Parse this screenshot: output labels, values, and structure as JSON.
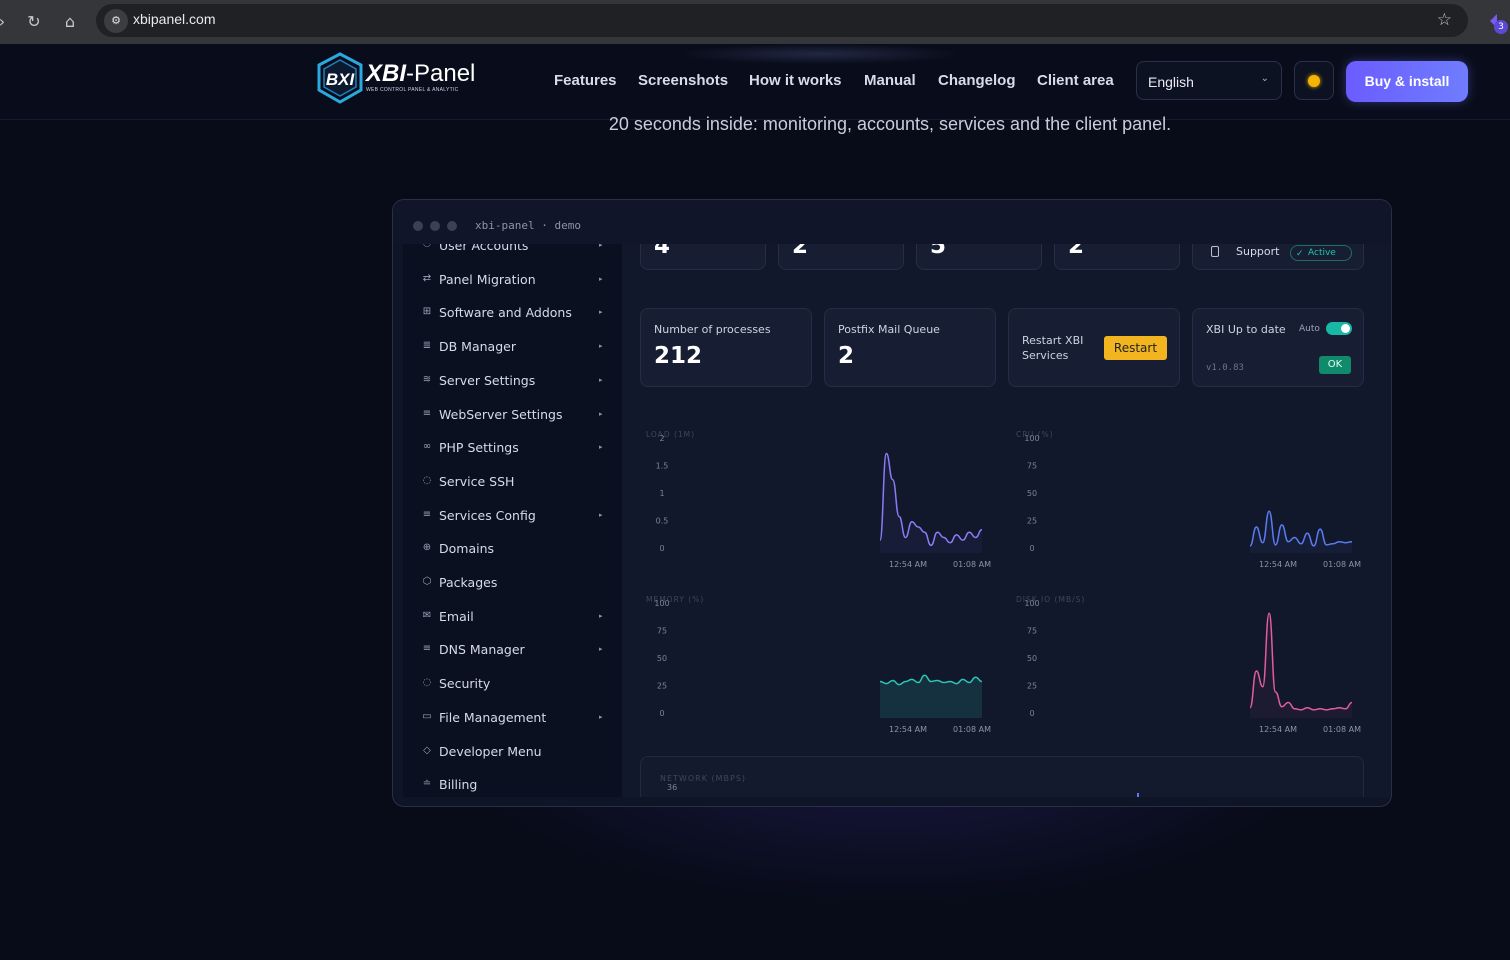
{
  "browser": {
    "url": "xbipanel.com",
    "extension_badge": "3"
  },
  "header": {
    "brand_main": "XBI",
    "brand_suffix": "-Panel",
    "brand_tagline": "WEB CONTROL PANEL & ANALYTIC",
    "logo_letters": "BXI",
    "nav": [
      "Features",
      "Screenshots",
      "How it works",
      "Manual",
      "Changelog",
      "Client area"
    ],
    "language": "English",
    "buy_label": "Buy & install"
  },
  "hero": {
    "subtitle": "20 seconds inside: monitoring, accounts, services and the client panel."
  },
  "demo": {
    "window_title": "xbi-panel · demo",
    "sidebar": [
      {
        "label": "User Accounts",
        "icon": "user-icon",
        "glyph": "⚇",
        "chevron": true
      },
      {
        "label": "Panel Migration",
        "icon": "migration-icon",
        "glyph": "⇄",
        "chevron": true
      },
      {
        "label": "Software and Addons",
        "icon": "grid-icon",
        "glyph": "⊞",
        "chevron": true
      },
      {
        "label": "DB Manager",
        "icon": "database-icon",
        "glyph": "≣",
        "chevron": true
      },
      {
        "label": "Server Settings",
        "icon": "layers-icon",
        "glyph": "≋",
        "chevron": true
      },
      {
        "label": "WebServer Settings",
        "icon": "menu-icon",
        "glyph": "≡",
        "chevron": true
      },
      {
        "label": "PHP Settings",
        "icon": "php-icon",
        "glyph": "∞",
        "chevron": true
      },
      {
        "label": "Service SSH",
        "icon": "shield-icon",
        "glyph": "◌",
        "chevron": false
      },
      {
        "label": "Services Config",
        "icon": "list-icon",
        "glyph": "≡",
        "chevron": true
      },
      {
        "label": "Domains",
        "icon": "globe-icon",
        "glyph": "⊕",
        "chevron": false
      },
      {
        "label": "Packages",
        "icon": "package-icon",
        "glyph": "⬡",
        "chevron": false
      },
      {
        "label": "Email",
        "icon": "mail-icon",
        "glyph": "✉",
        "chevron": true
      },
      {
        "label": "DNS Manager",
        "icon": "dns-icon",
        "glyph": "≡",
        "chevron": true
      },
      {
        "label": "Security",
        "icon": "security-icon",
        "glyph": "◌",
        "chevron": false
      },
      {
        "label": "File Management",
        "icon": "folder-icon",
        "glyph": "▭",
        "chevron": true
      },
      {
        "label": "Developer Menu",
        "icon": "code-icon",
        "glyph": "◇",
        "chevron": false
      },
      {
        "label": "Billing",
        "icon": "billing-icon",
        "glyph": "≐",
        "chevron": false
      }
    ],
    "top_cards": [
      {
        "value": "4"
      },
      {
        "value": "2"
      },
      {
        "value": "5"
      },
      {
        "value": "2"
      }
    ],
    "support": {
      "label": "Support",
      "status": "Active"
    },
    "processes": {
      "label": "Number of processes",
      "value": "212"
    },
    "mail_queue": {
      "label": "Postfix Mail Queue",
      "value": "2"
    },
    "restart": {
      "label_line1": "Restart XBI",
      "label_line2": "Services",
      "button": "Restart"
    },
    "update": {
      "label": "XBI Up to date",
      "auto": "Auto",
      "version": "v1.0.83",
      "ok": "OK"
    },
    "network_title": "NETWORK (MBPS)",
    "network_first_tick": "36"
  },
  "chart_data": [
    {
      "type": "line",
      "title": "LOAD (1M)",
      "ylim": [
        0,
        2
      ],
      "yticks": [
        "2",
        "1.5",
        "1",
        "0.5",
        "0"
      ],
      "xticks": [
        "12:54 AM",
        "01:08 AM"
      ],
      "color": "#8b7cf6",
      "values": [
        0.15,
        1.8,
        1.3,
        0.6,
        0.2,
        0.5,
        0.4,
        0.3,
        0.05,
        0.3,
        0.2,
        0.1,
        0.25,
        0.15,
        0.3,
        0.2,
        0.35
      ]
    },
    {
      "type": "line",
      "title": "CPU (%)",
      "ylim": [
        0,
        100
      ],
      "yticks": [
        "100",
        "75",
        "50",
        "25",
        "0"
      ],
      "xticks": [
        "12:54 AM",
        "01:08 AM"
      ],
      "color": "#5b7cf0",
      "values": [
        2,
        20,
        5,
        35,
        3,
        22,
        6,
        10,
        4,
        14,
        2,
        18,
        3,
        4,
        6,
        5,
        6
      ]
    },
    {
      "type": "area",
      "title": "MEMORY (%)",
      "ylim": [
        0,
        100
      ],
      "yticks": [
        "100",
        "75",
        "50",
        "25",
        "0"
      ],
      "xticks": [
        "12:54 AM",
        "01:08 AM"
      ],
      "color": "#2bc7b4",
      "values": [
        30,
        28,
        31,
        27,
        30,
        32,
        29,
        36,
        30,
        31,
        29,
        30,
        28,
        32,
        29,
        34,
        30
      ]
    },
    {
      "type": "line",
      "title": "DISK IO (MB/S)",
      "ylim": [
        0,
        100
      ],
      "yticks": [
        "100",
        "75",
        "50",
        "25",
        "0"
      ],
      "xticks": [
        "12:54 AM",
        "01:08 AM"
      ],
      "color": "#e45b9e",
      "values": [
        5,
        40,
        25,
        95,
        20,
        6,
        10,
        4,
        3,
        5,
        3,
        4,
        3,
        4,
        5,
        4,
        10
      ]
    }
  ]
}
